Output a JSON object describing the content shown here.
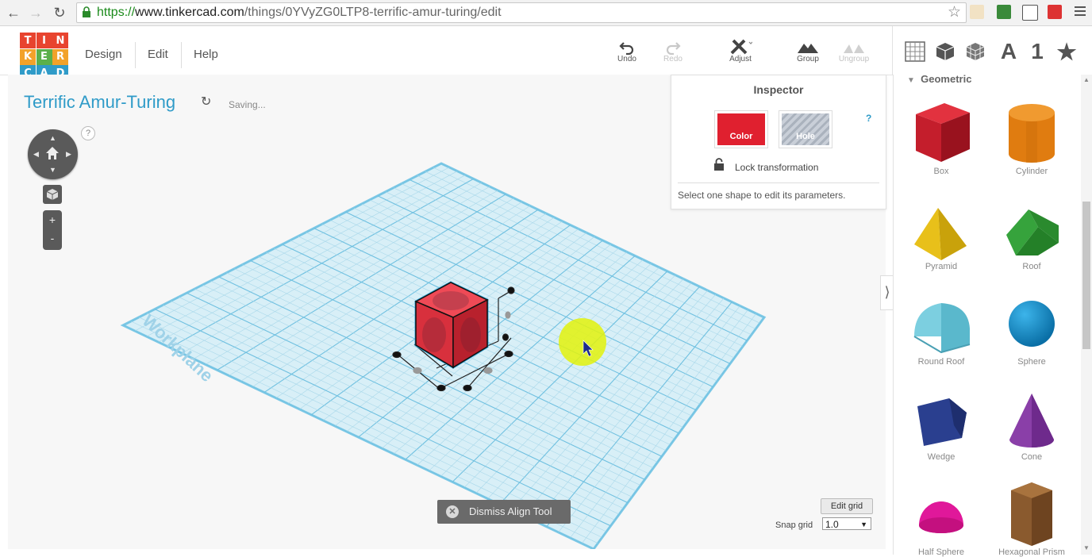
{
  "browser": {
    "url_https": "https://",
    "url_host": "www.tinkercad.com",
    "url_path": "/things/0YVyZG0LTP8-terrific-amur-turing/edit"
  },
  "logo": {
    "letters": [
      "T",
      "I",
      "N",
      "K",
      "E",
      "R",
      "C",
      "A",
      "D"
    ],
    "colors": [
      "#e8442f",
      "#e8442f",
      "#e8442f",
      "#f2a22a",
      "#5bb04b",
      "#f2a22a",
      "#2f9bc8",
      "#2f9bc8",
      "#2f9bc8"
    ]
  },
  "menu": {
    "design": "Design",
    "edit": "Edit",
    "help": "Help"
  },
  "toolbar": {
    "undo": "Undo",
    "redo": "Redo",
    "adjust": "Adjust",
    "group": "Group",
    "ungroup": "Ungroup"
  },
  "view_icons": {
    "text_icon": "A",
    "number_icon": "1"
  },
  "document": {
    "title": "Terrific Amur-Turing",
    "status": "Saving...",
    "workplane_label": "Workplane"
  },
  "inspector": {
    "title": "Inspector",
    "help": "?",
    "color_label": "Color",
    "hole_label": "Hole",
    "lock_label": "Lock transformation",
    "message": "Select one shape to edit its parameters."
  },
  "align_tool": {
    "dismiss_label": "Dismiss Align Tool"
  },
  "grid": {
    "edit_label": "Edit grid",
    "snap_label": "Snap grid",
    "snap_value": "1.0"
  },
  "nav_help": "?",
  "shapes_panel": {
    "category": "Geometric",
    "items": [
      {
        "label": "Box"
      },
      {
        "label": "Cylinder"
      },
      {
        "label": "Pyramid"
      },
      {
        "label": "Roof"
      },
      {
        "label": "Round Roof"
      },
      {
        "label": "Sphere"
      },
      {
        "label": "Wedge"
      },
      {
        "label": "Cone"
      },
      {
        "label": "Half Sphere"
      },
      {
        "label": "Hexagonal Prism"
      }
    ]
  },
  "colors": {
    "accent": "#2f9bc8",
    "workplane": "#c8e6f0",
    "selected_shape": "#e0313f",
    "cursor_highlight": "#e3f20c"
  }
}
